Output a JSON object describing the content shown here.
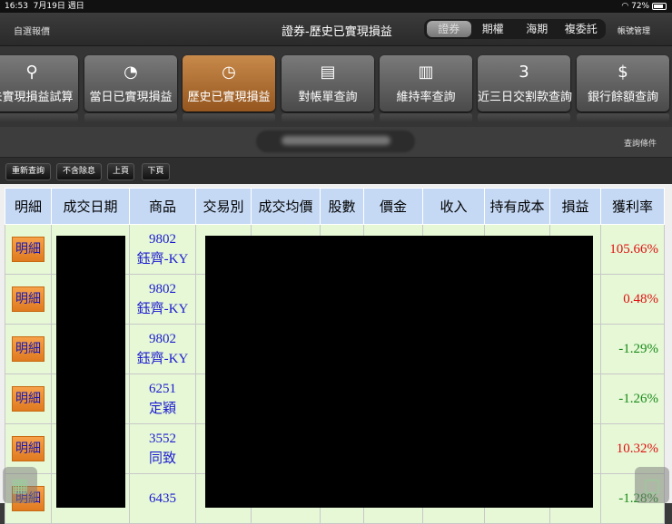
{
  "status": {
    "time": "16:53",
    "date": "7月19日 週日",
    "battery": "72%"
  },
  "nav": {
    "left": "自選報價",
    "title": "證券-歷史已實現損益",
    "segments": [
      "證券",
      "期權",
      "海期",
      "複委託"
    ],
    "account": "帳號管理"
  },
  "tiles": [
    {
      "label": "未實現損益試算",
      "icon": "search-chart-icon",
      "glyph": "⚲"
    },
    {
      "label": "當日已實現損益",
      "icon": "clock-doc-icon",
      "glyph": "◔"
    },
    {
      "label": "歷史已實現損益",
      "icon": "history-doc-icon",
      "glyph": "◷"
    },
    {
      "label": "對帳單查詢",
      "icon": "statement-icon",
      "glyph": "▤"
    },
    {
      "label": "維持率查詢",
      "icon": "bar-chart-icon",
      "glyph": "▥"
    },
    {
      "label": "近三日交割款查詢",
      "icon": "calendar-money-icon",
      "glyph": "3"
    },
    {
      "label": "銀行餘額查詢",
      "icon": "money-search-icon",
      "glyph": "$"
    }
  ],
  "query": {
    "conditions": "查詢條件"
  },
  "toolbar": {
    "requery": "重新查詢",
    "no_dividend": "不含除息",
    "prev": "上頁",
    "next": "下頁"
  },
  "table": {
    "headers": [
      "明細",
      "成交日期",
      "商品",
      "交易別",
      "成交均價",
      "股數",
      "價金",
      "收入",
      "持有成本",
      "損益",
      "獲利率"
    ],
    "detail_label": "明細",
    "rows": [
      {
        "code": "9802",
        "name": "鈺齊-KY",
        "rate": "105.66%",
        "color": "red"
      },
      {
        "code": "9802",
        "name": "鈺齊-KY",
        "rate": "0.48%",
        "color": "red"
      },
      {
        "code": "9802",
        "name": "鈺齊-KY",
        "rate": "-1.29%",
        "color": "green"
      },
      {
        "code": "6251",
        "name": "定穎",
        "rate": "-1.26%",
        "color": "green"
      },
      {
        "code": "3552",
        "name": "同致",
        "rate": "10.32%",
        "color": "red"
      },
      {
        "code": "6435",
        "name": "",
        "rate": "-1.28%",
        "color": "green"
      }
    ]
  }
}
